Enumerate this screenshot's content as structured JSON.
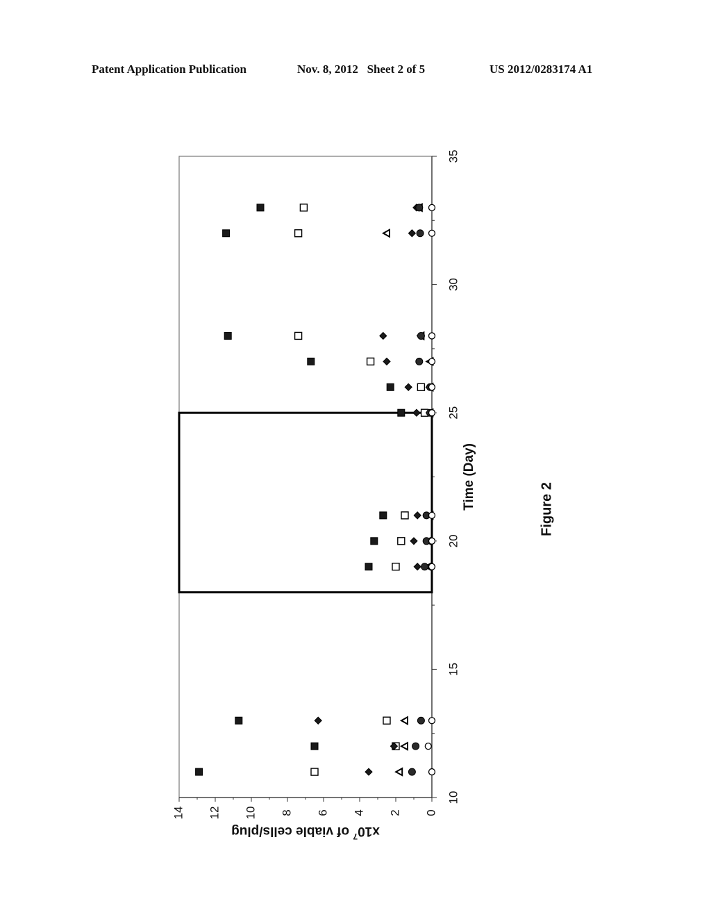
{
  "header": {
    "left": "Patent Application Publication",
    "middle": "Nov. 8, 2012   Sheet 2 of 5",
    "right": "US 2012/0283174 A1"
  },
  "figure_label": "Figure 2",
  "chart_data": {
    "type": "scatter",
    "orientation": "rotated 90° counter-clockwise on page",
    "title": "",
    "xlabel": "Time (Day)",
    "ylabel": "x10^7 of viable cells/plug",
    "ylabel_parts": {
      "prefix": "x10",
      "exponent": "7",
      "suffix": " of viable cells/plug"
    },
    "xlim": [
      10,
      35
    ],
    "ylim": [
      0,
      14
    ],
    "xticks": [
      "10",
      "15",
      "20",
      "25",
      "30",
      "35"
    ],
    "yticks": [
      "0",
      "2",
      "4",
      "6",
      "8",
      "10",
      "12",
      "14"
    ],
    "grid": false,
    "legend": "none",
    "annotation_box": {
      "x_range": [
        18,
        25
      ],
      "y_range": [
        0,
        14
      ],
      "style": "bold outline"
    },
    "x": [
      11,
      12,
      13,
      19,
      20,
      21,
      25,
      26,
      27,
      28,
      32,
      33
    ],
    "series": [
      {
        "name": "filled-square",
        "marker": "filled-square",
        "values": [
          12.9,
          6.5,
          10.7,
          3.5,
          3.2,
          2.7,
          1.7,
          2.3,
          6.7,
          11.3,
          11.4,
          9.5
        ]
      },
      {
        "name": "open-square",
        "marker": "open-square",
        "values": [
          6.5,
          2.0,
          2.5,
          2.0,
          1.7,
          1.5,
          0.4,
          0.6,
          3.4,
          7.4,
          7.4,
          7.1
        ]
      },
      {
        "name": "diamond",
        "marker": "diamond",
        "values": [
          3.5,
          2.1,
          6.3,
          0.8,
          1.0,
          0.8,
          0.85,
          1.3,
          2.5,
          2.7,
          1.1,
          0.85
        ]
      },
      {
        "name": "triangle",
        "marker": "triangle",
        "values": [
          1.8,
          1.5,
          1.5,
          0.2,
          0.2,
          0.1,
          0.1,
          0.1,
          0.1,
          0.6,
          2.5,
          0.7
        ]
      },
      {
        "name": "filled-circle",
        "marker": "filled-circle",
        "values": [
          1.1,
          0.9,
          0.6,
          0.4,
          0.3,
          0.3,
          0.1,
          0.1,
          0.7,
          0.6,
          0.65,
          0.7
        ]
      },
      {
        "name": "open-circle",
        "marker": "open-circle",
        "values": [
          0,
          0.2,
          0,
          0,
          0,
          0,
          0,
          0,
          0,
          0,
          0,
          0
        ]
      }
    ]
  }
}
